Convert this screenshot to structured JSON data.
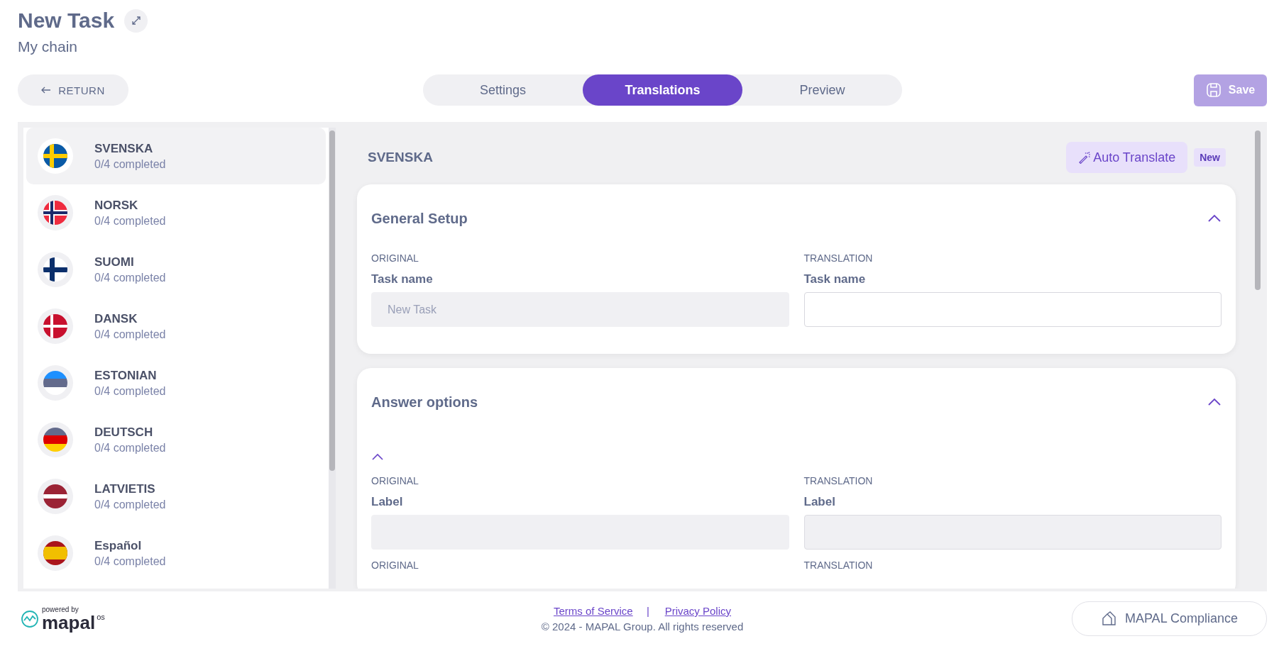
{
  "header": {
    "title": "New Task",
    "subtitle": "My chain"
  },
  "return_button": "RETURN",
  "tabs": [
    {
      "label": "Settings",
      "selected": false
    },
    {
      "label": "Translations",
      "selected": true
    },
    {
      "label": "Preview",
      "selected": false
    }
  ],
  "save_button": {
    "label": "Save",
    "disabled": true
  },
  "languages": [
    {
      "name": "SVENSKA",
      "progress": "0/4 completed",
      "selected": true
    },
    {
      "name": "NORSK",
      "progress": "0/4 completed",
      "selected": false
    },
    {
      "name": "SUOMI",
      "progress": "0/4 completed",
      "selected": false
    },
    {
      "name": "DANSK",
      "progress": "0/4 completed",
      "selected": false
    },
    {
      "name": "ESTONIAN",
      "progress": "0/4 completed",
      "selected": false
    },
    {
      "name": "DEUTSCH",
      "progress": "0/4 completed",
      "selected": false
    },
    {
      "name": "LATVIETIS",
      "progress": "0/4 completed",
      "selected": false
    },
    {
      "name": "Español",
      "progress": "0/4 completed",
      "selected": false
    }
  ],
  "editor": {
    "language": "SVENSKA",
    "auto_translate": "Auto Translate",
    "badge": "New",
    "sections": [
      {
        "title": "General Setup",
        "expanded": true,
        "rows": [
          {
            "original_heading": "ORIGINAL",
            "translation_heading": "TRANSLATION",
            "original_label": "Task name",
            "translation_label": "Task name",
            "original_field": {
              "value": "New Task",
              "disabled": true
            },
            "translation_field": {
              "disabled": false
            }
          }
        ]
      },
      {
        "title": "Answer options",
        "expanded": true,
        "subgroup": {
          "expanded": true
        },
        "rows": [
          {
            "original_heading": "ORIGINAL",
            "translation_heading": "TRANSLATION",
            "original_label": "Label",
            "translation_label": "Label",
            "original_field": {
              "disabled": true
            },
            "translation_field": {
              "disabled": true
            }
          },
          {
            "original_heading": "ORIGINAL",
            "translation_heading": "TRANSLATION"
          }
        ]
      }
    ]
  },
  "footer": {
    "powered_by": "powered by",
    "logo": "mapal",
    "logo_suffix": "os",
    "links": [
      {
        "label": "Terms of Service"
      },
      {
        "label": "Privacy Policy"
      }
    ],
    "separator": "|",
    "copyright": "© 2024 - MAPAL Group. All rights reserved",
    "compliance_button": "MAPAL Compliance"
  }
}
